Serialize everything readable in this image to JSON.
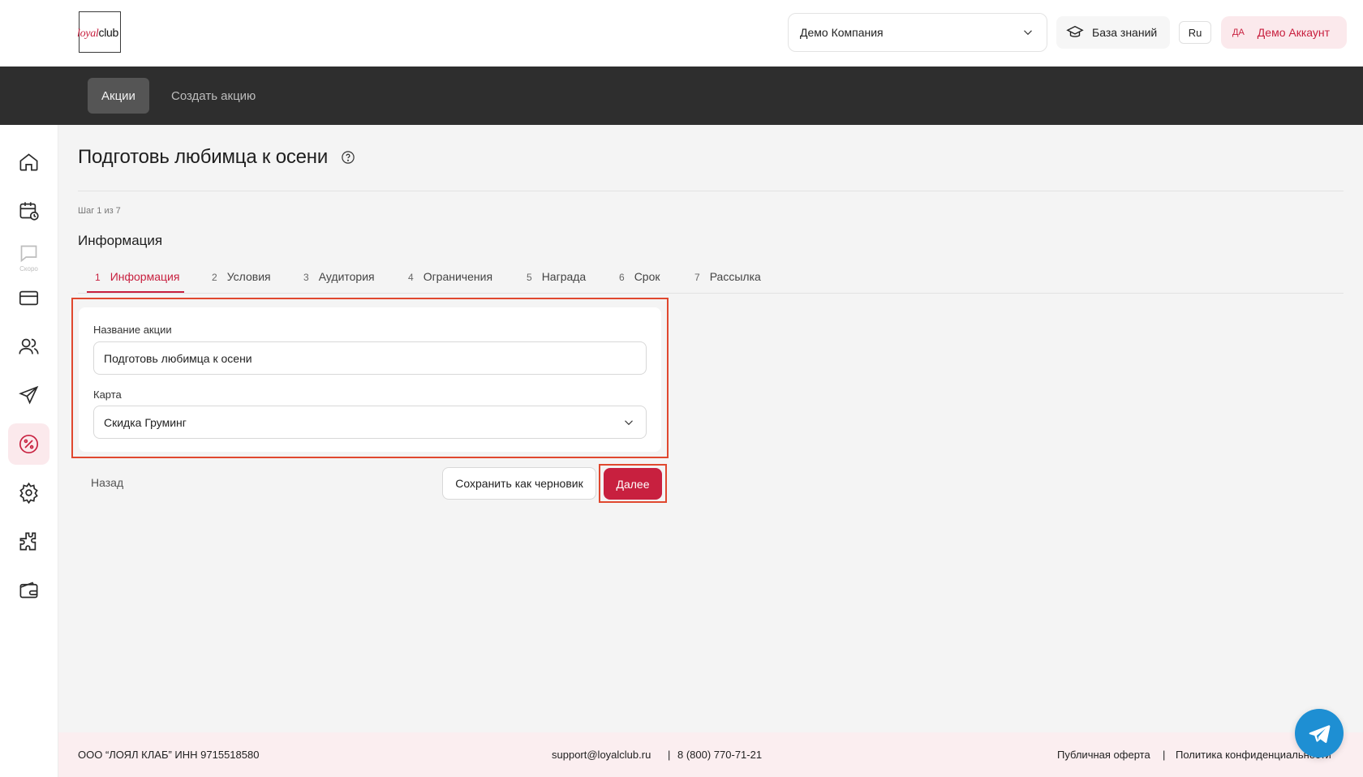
{
  "header": {
    "logo_loyal": "loyal",
    "logo_club": "club",
    "company": "Демо Компания",
    "knowledge_base": "База знаний",
    "language": "Ru",
    "account_initials": "ДА",
    "account_name": "Демо Аккаунт"
  },
  "nav": {
    "tabs": [
      {
        "label": "Акции",
        "active": true
      },
      {
        "label": "Создать акцию",
        "active": false
      }
    ]
  },
  "sidebar": {
    "items": [
      {
        "icon": "home-icon"
      },
      {
        "icon": "calendar-clock-icon"
      },
      {
        "icon": "chat-icon",
        "badge": "Скоро",
        "disabled": true
      },
      {
        "icon": "card-icon"
      },
      {
        "icon": "users-icon"
      },
      {
        "icon": "send-icon"
      },
      {
        "icon": "percent-icon",
        "active": true
      },
      {
        "icon": "gear-icon"
      },
      {
        "icon": "puzzle-icon"
      },
      {
        "icon": "wallet-icon"
      }
    ]
  },
  "page": {
    "title": "Подготовь любимца к осени",
    "step_count": "Шаг 1 из 7",
    "section_title": "Информация"
  },
  "steps": [
    {
      "num": "1",
      "label": "Информация",
      "active": true
    },
    {
      "num": "2",
      "label": "Условия"
    },
    {
      "num": "3",
      "label": "Аудитория"
    },
    {
      "num": "4",
      "label": "Ограничения"
    },
    {
      "num": "5",
      "label": "Награда"
    },
    {
      "num": "6",
      "label": "Срок"
    },
    {
      "num": "7",
      "label": "Рассылка"
    }
  ],
  "form": {
    "name_label": "Название акции",
    "name_value": "Подготовь любимца к осени",
    "card_label": "Карта",
    "card_value": "Скидка Груминг"
  },
  "actions": {
    "back": "Назад",
    "save_draft": "Сохранить как черновик",
    "next": "Далее"
  },
  "footer": {
    "company": "ООО “ЛОЯЛ КЛАБ” ИНН 9715518580",
    "email": "support@loyalclub.ru",
    "separator": "|",
    "phone": "8 (800) 770-71-21",
    "offer": "Публичная оферта",
    "privacy": "Политика конфиденциальности"
  },
  "colors": {
    "accent": "#c8203f",
    "nav_bg": "#2e2e2e",
    "highlight": "#e0482f",
    "telegram": "#1e8fd3"
  }
}
